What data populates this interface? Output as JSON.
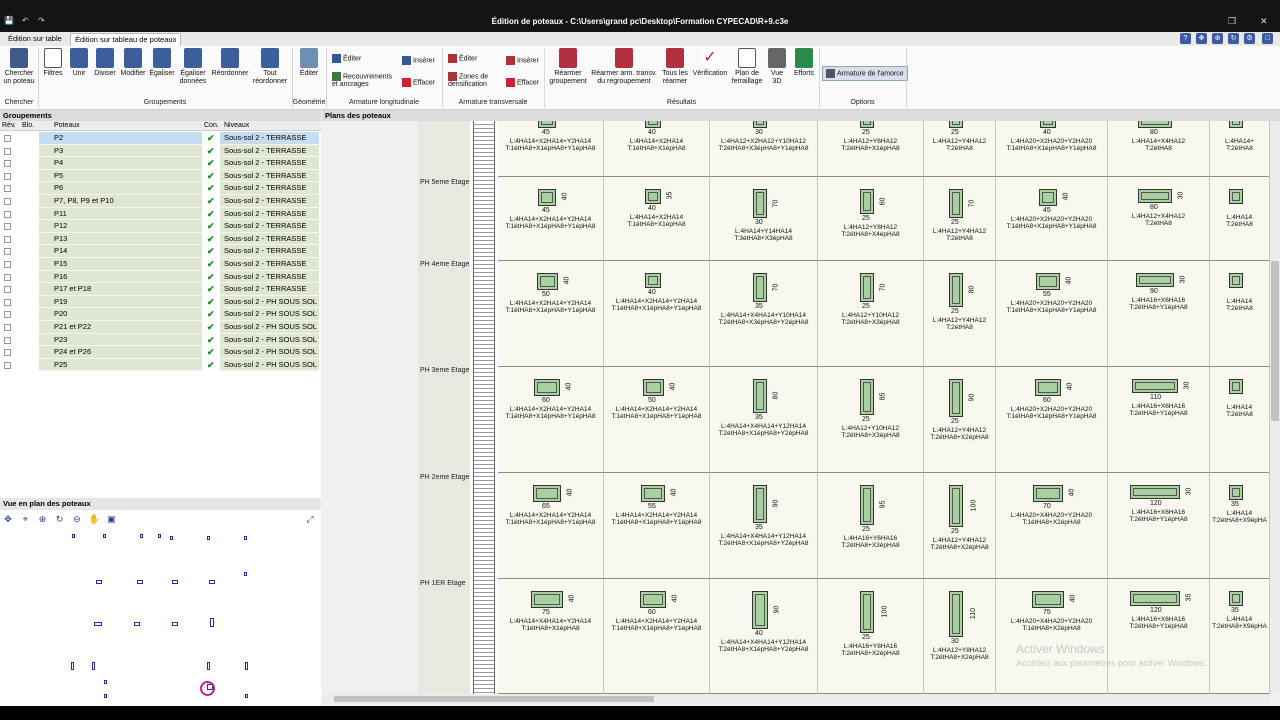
{
  "window": {
    "title": "Édition de poteaux - C:\\Users\\grand pc\\Desktop\\Formation CYPECAD\\R+9.c3e"
  },
  "tabs": [
    {
      "label": "Édition sur table"
    },
    {
      "label": "Édition sur tableau de poteaux"
    }
  ],
  "ribbon": {
    "chercher": {
      "label": "Chercher\nun poteau",
      "group": "Chercher"
    },
    "groupements": {
      "group": "Groupements",
      "items": [
        "Filtres",
        "Unir",
        "Diviser",
        "Modifier",
        "Égaliser",
        "Égaliser\ndonnées",
        "Réordonner",
        "Tout\nréordonner"
      ]
    },
    "geometrie": {
      "group": "Géométrie",
      "items": [
        "Éditer"
      ]
    },
    "armature_longitudinale": {
      "group": "Armature longitudinale",
      "items": [
        "Éditer",
        "Recouvrements\net ancrages",
        "Insérer",
        "Effacer"
      ]
    },
    "armature_transversale": {
      "group": "Armature transversale",
      "items": [
        "Éditer",
        "Zones de\ndensification",
        "Insérer",
        "Effacer"
      ]
    },
    "resultats": {
      "group": "Résultats",
      "items": [
        "Réarmer\ngroupement",
        "Réarmer arm. transv.\ndu regroupement",
        "Tous les\nréarmer",
        "Vérification",
        "Plan de\nferraillage",
        "Vue\n3D",
        "Efforts"
      ]
    },
    "options": {
      "group": "Options",
      "items": [
        "Armature de l'amorce"
      ]
    }
  },
  "groupements_panel": {
    "title": "Groupements",
    "columns": [
      "Rév.",
      "Blo.",
      "Poteaux",
      "Con.",
      "Niveaux"
    ],
    "rows": [
      {
        "name": "P2",
        "level": "Sous-sol 2 - TERRASSE"
      },
      {
        "name": "P3",
        "level": "Sous-sol 2 - TERRASSE"
      },
      {
        "name": "P4",
        "level": "Sous-sol 2 - TERRASSE"
      },
      {
        "name": "P5",
        "level": "Sous-sol 2 - TERRASSE"
      },
      {
        "name": "P6",
        "level": "Sous-sol 2 - TERRASSE"
      },
      {
        "name": "P7, P8, P9 et P10",
        "level": "Sous-sol 2 - TERRASSE"
      },
      {
        "name": "P11",
        "level": "Sous-sol 2 - TERRASSE"
      },
      {
        "name": "P12",
        "level": "Sous-sol 2 - TERRASSE"
      },
      {
        "name": "P13",
        "level": "Sous-sol 2 - TERRASSE"
      },
      {
        "name": "P14",
        "level": "Sous-sol 2 - TERRASSE"
      },
      {
        "name": "P15",
        "level": "Sous-sol 2 - TERRASSE"
      },
      {
        "name": "P16",
        "level": "Sous-sol 2 - TERRASSE"
      },
      {
        "name": "P17 et P18",
        "level": "Sous-sol 2 - TERRASSE"
      },
      {
        "name": "P19",
        "level": "Sous-sol 2 - PH SOUS SOL 1"
      },
      {
        "name": "P20",
        "level": "Sous-sol 2 - PH SOUS SOL 1"
      },
      {
        "name": "P21 et P22",
        "level": "Sous-sol 2 - PH SOUS SOL 1"
      },
      {
        "name": "P23",
        "level": "Sous-sol 2 - PH SOUS SOL 1"
      },
      {
        "name": "P24 et P26",
        "level": "Sous-sol 2 - PH SOUS SOL 1"
      },
      {
        "name": "P25",
        "level": "Sous-sol 2 - PH SOUS SOL 1"
      }
    ]
  },
  "plan_view": {
    "title": "Vue en plan des poteaux"
  },
  "plans_panel": {
    "title": "Plans des poteaux"
  },
  "levels": [
    "PH 5eme Etage",
    "PH 4eme Etage",
    "PH 3eme Etage",
    "PH 2eme Etage",
    "PH 1ER Etage"
  ],
  "grid": {
    "rows": [
      {
        "cells": [
          {
            "w": "45",
            "h": "",
            "lbl": "L:4HA14+X2HA14+Y2HA14\nT:1étHA8+X1épHA8+Y1épHA8"
          },
          {
            "w": "40",
            "h": "",
            "lbl": "L:4HA14+X2HA14\nT:1étHA8+X1épHA8"
          },
          {
            "w": "30",
            "h": "",
            "lbl": "L:4HA12+X2HA12+Y10HA12\nT:2étHA8+X3épHA8+Y1épHA8"
          },
          {
            "w": "25",
            "h": "",
            "lbl": "L:4HA12+Y6HA12\nT:2étHA8+X1épHA8"
          },
          {
            "w": "25",
            "h": "",
            "lbl": "L:4HA12+Y4HA12\nT:2étHA8"
          },
          {
            "w": "40",
            "h": "",
            "lbl": "L:4HA20+X2HA20+Y2HA20\nT:1étHA8+X1épHA8+Y1épHA8"
          },
          {
            "w": "80",
            "h": "",
            "lbl": "L:4HA14+X4HA12\nT:2étHA8"
          },
          {
            "w": "",
            "h": "",
            "lbl": "L:4HA14+\nT:2étHA8"
          }
        ]
      },
      {
        "cells": [
          {
            "w": "45",
            "h": "40",
            "lbl": "L:4HA14+X2HA14+Y2HA14\nT:1étHA8+X1épHA8+Y1épHA8"
          },
          {
            "w": "40",
            "h": "35",
            "lbl": "L:4HA14+X2HA14\nT:1étHA8+X1épHA8"
          },
          {
            "w": "30",
            "h": "70",
            "lbl": "L:4HA14+Y14HA14\nT:3étHA8+X3épHA8"
          },
          {
            "w": "25",
            "h": "60",
            "lbl": "L:4HA12+Y8HA12\nT:2étHA8+X4épHA8"
          },
          {
            "w": "25",
            "h": "70",
            "lbl": "L:4HA12+Y4HA12\nT:2étHA8"
          },
          {
            "w": "45",
            "h": "40",
            "lbl": "L:4HA20+X2HA20+Y2HA20\nT:1étHA8+X1épHA8+Y1épHA8"
          },
          {
            "w": "80",
            "h": "30",
            "lbl": "L:4HA12+X4HA12\nT:2étHA8"
          },
          {
            "w": "",
            "h": "",
            "lbl": "L:4HA14\nT:2étHA8"
          }
        ]
      },
      {
        "cells": [
          {
            "w": "50",
            "h": "40",
            "lbl": "L:4HA14+X2HA14+Y2HA14\nT:1étHA8+X1épHA8+Y1épHA8"
          },
          {
            "w": "40",
            "h": "",
            "lbl": "L:4HA14+X2HA14+Y2HA14\nT:1étHA8+X1épHA8+Y1épHA8"
          },
          {
            "w": "35",
            "h": "70",
            "lbl": "L:4HA14+X4HA14+Y10HA14\nT:2étHA8+X3épHA8+Y2épHA8"
          },
          {
            "w": "25",
            "h": "70",
            "lbl": "L:4HA12+Y10HA12\nT:2étHA8+X3épHA8"
          },
          {
            "w": "25",
            "h": "80",
            "lbl": "L:4HA12+Y4HA12\nT:2étHA8"
          },
          {
            "w": "55",
            "h": "40",
            "lbl": "L:4HA20+X2HA20+Y2HA20\nT:1étHA8+X1épHA8+Y1épHA8"
          },
          {
            "w": "90",
            "h": "30",
            "lbl": "L:4HA16+X6HA16\nT:2étHA8+Y1épHA8"
          },
          {
            "w": "",
            "h": "",
            "lbl": "L:4HA14\nT:2étHA8"
          }
        ]
      },
      {
        "cells": [
          {
            "w": "60",
            "h": "40",
            "lbl": "L:4HA14+X2HA14+Y2HA14\nT:1étHA8+X1épHA8+Y1épHA8"
          },
          {
            "w": "50",
            "h": "40",
            "lbl": "L:4HA14+X2HA14+Y2HA14\nT:1étHA8+X1épHA8+Y1épHA8"
          },
          {
            "w": "35",
            "h": "80",
            "lbl": "L:4HA14+X4HA14+Y12HA14\nT:2étHA8+X1épHA8+Y2épHA8"
          },
          {
            "w": "25",
            "h": "85",
            "lbl": "L:4HA12+Y10HA12\nT:2étHA8+X3épHA8"
          },
          {
            "w": "25",
            "h": "90",
            "lbl": "L:4HA12+Y4HA12\nT:2étHA8+X2épHA8"
          },
          {
            "w": "60",
            "h": "40",
            "lbl": "L:4HA20+X2HA20+Y2HA20\nT:1étHA8+X1épHA8+Y1épHA8"
          },
          {
            "w": "110",
            "h": "30",
            "lbl": "L:4HA16+X6HA16\nT:2étHA8+Y1épHA8"
          },
          {
            "w": "",
            "h": "",
            "lbl": "L:4HA14\nT:2étHA8"
          }
        ]
      },
      {
        "cells": [
          {
            "w": "65",
            "h": "40",
            "lbl": "L:4HA14+X2HA14+Y2HA14\nT:1étHA8+X1épHA8+Y1épHA8"
          },
          {
            "w": "55",
            "h": "40",
            "lbl": "L:4HA14+X2HA14+Y2HA14\nT:1étHA8+X1épHA8+Y1épHA8"
          },
          {
            "w": "35",
            "h": "90",
            "lbl": "L:4HA14+X4HA14+Y12HA14\nT:2étHA8+X1épHA8+Y2épHA8"
          },
          {
            "w": "25",
            "h": "95",
            "lbl": "L:4HA16+Y6HA16\nT:2étHA8+X3épHA8"
          },
          {
            "w": "25",
            "h": "100",
            "lbl": "L:4HA12+Y4HA12\nT:2étHA8+X2épHA8"
          },
          {
            "w": "70",
            "h": "40",
            "lbl": "L:4HA20+X4HA20+Y2HA20\nT:1étHA8+X2épHA8"
          },
          {
            "w": "120",
            "h": "30",
            "lbl": "L:4HA16+X6HA16\nT:2étHA8+Y1épHA8"
          },
          {
            "w": "35",
            "h": "",
            "lbl": "L:4HA14\nT:2étHA8+X9épHA"
          }
        ]
      },
      {
        "cells": [
          {
            "w": "75",
            "h": "40",
            "lbl": "L:4HA14+X4HA14+Y2HA14\nT:1étHA8+X1épHA8"
          },
          {
            "w": "60",
            "h": "40",
            "lbl": "L:4HA14+X2HA14+Y2HA14\nT:1étHA8+X1épHA8+Y1épHA8"
          },
          {
            "w": "40",
            "h": "90",
            "lbl": "L:4HA14+X4HA14+Y12HA14\nT:2étHA8+X1épHA8+Y2épHA8"
          },
          {
            "w": "25",
            "h": "100",
            "lbl": "L:4HA16+Y8HA16\nT:2étHA8+X2épHA8"
          },
          {
            "w": "30",
            "h": "110",
            "lbl": "L:4HA12+Y8HA12\nT:2étHA8+X2épHA8"
          },
          {
            "w": "75",
            "h": "40",
            "lbl": "L:4HA20+X4HA20+Y2HA20\nT:1étHA8+X2épHA8"
          },
          {
            "w": "120",
            "h": "35",
            "lbl": "L:4HA16+X6HA16\nT:2étHA8+Y1épHA8"
          },
          {
            "w": "35",
            "h": "",
            "lbl": "L:4HA14\nT:2étHA8+X9épHA"
          }
        ]
      }
    ]
  },
  "watermark": {
    "line1": "Activer Windows",
    "line2": "Accédez aux paramètres pour activer Windows."
  },
  "colors": {
    "accent": "#3b5aa8",
    "selected_row": "#c6dcf0",
    "group_row": "#dfe6d2",
    "section_fill": "#a8d0a0"
  }
}
